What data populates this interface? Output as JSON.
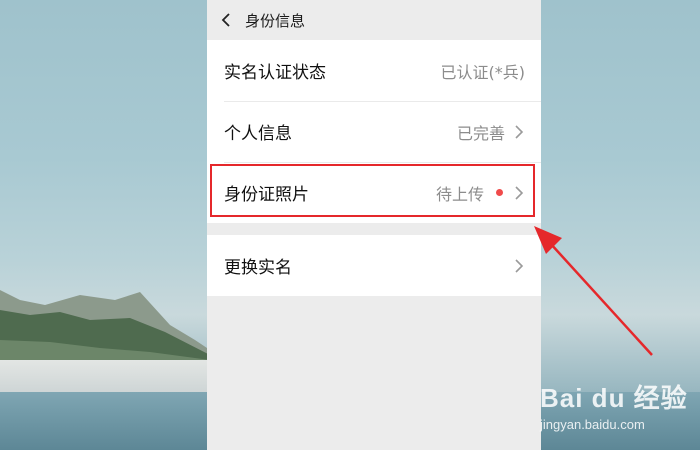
{
  "nav": {
    "title": "身份信息"
  },
  "rows_group1": [
    {
      "label": "实名认证状态",
      "value": "已认证(*兵)",
      "chevron": false,
      "dot": false
    },
    {
      "label": "个人信息",
      "value": "已完善",
      "chevron": true,
      "dot": false
    },
    {
      "label": "身份证照片",
      "value": "待上传",
      "chevron": true,
      "dot": true
    }
  ],
  "rows_group2": [
    {
      "label": "更换实名",
      "value": "",
      "chevron": true,
      "dot": false
    }
  ],
  "watermark": {
    "brand": "Bai du 经验",
    "url": "jingyan.baidu.com"
  },
  "colors": {
    "highlight": "#e5282b",
    "dot": "#f04b4b"
  }
}
